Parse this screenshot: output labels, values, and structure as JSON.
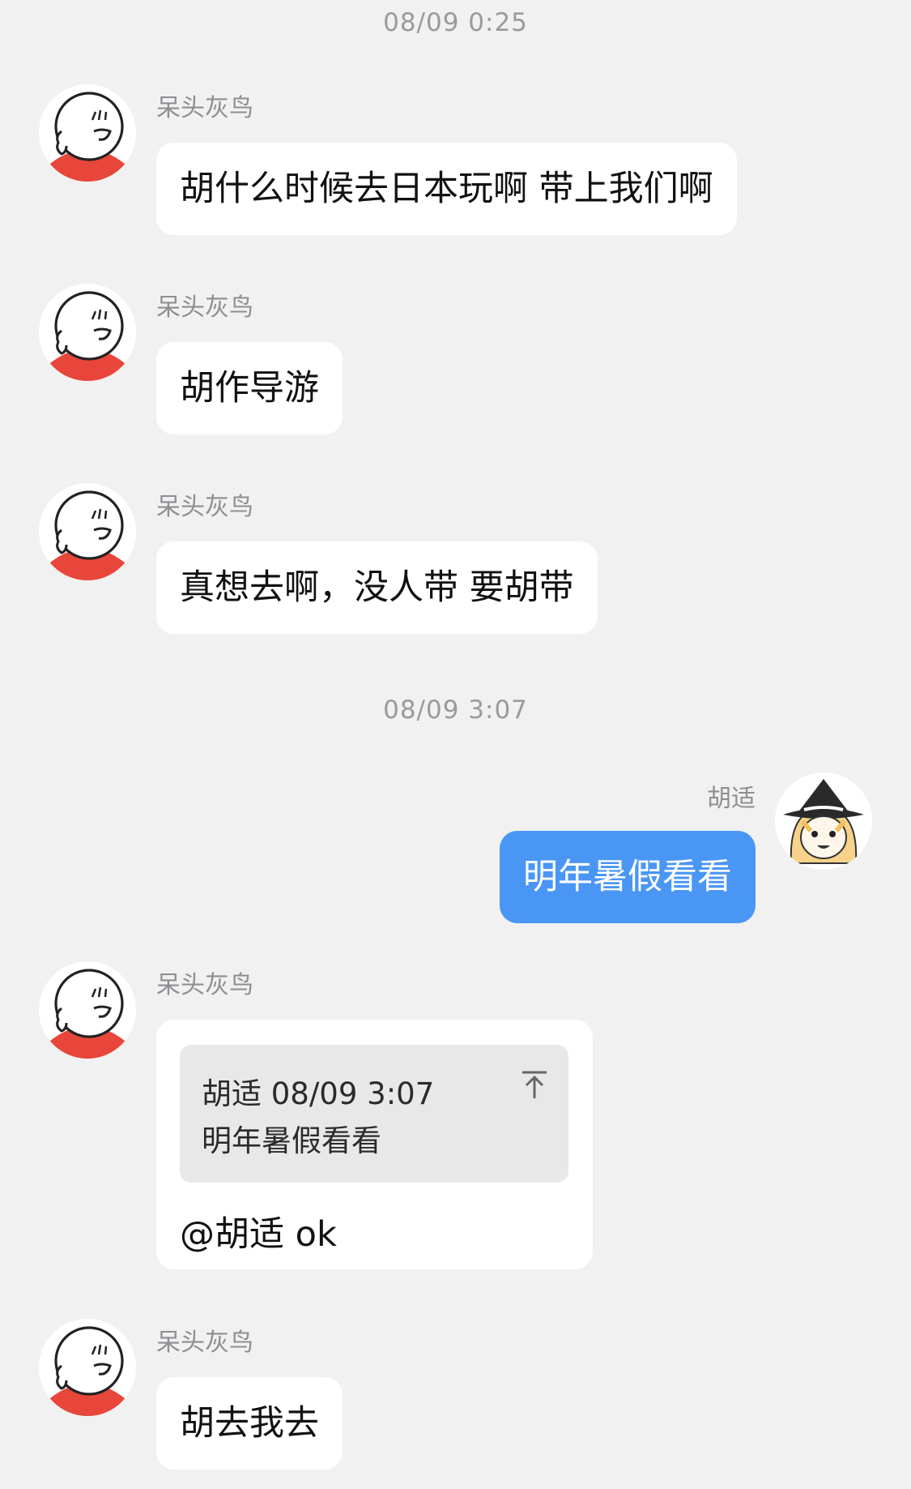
{
  "chat": {
    "timestamps": [
      "08/09 0:25",
      "08/09 3:07"
    ],
    "messages": [
      {
        "sender": "呆头灰鸟",
        "text": "胡什么时候去日本玩啊 带上我们啊",
        "side": "left"
      },
      {
        "sender": "呆头灰鸟",
        "text": "胡作导游",
        "side": "left"
      },
      {
        "sender": "呆头灰鸟",
        "text": "真想去啊，没人带 要胡带",
        "side": "left"
      },
      {
        "sender": "胡适",
        "text": "明年暑假看看",
        "side": "right"
      },
      {
        "sender": "呆头灰鸟",
        "side": "left",
        "quote": {
          "header": "胡适 08/09 3:07",
          "text": "明年暑假看看",
          "icon": "scroll-to-top-icon"
        },
        "text": "@胡适 ok"
      },
      {
        "sender": "呆头灰鸟",
        "text": "胡去我去",
        "side": "left"
      }
    ]
  },
  "colors": {
    "background": "#f1f1f1",
    "bubble_other": "#ffffff",
    "bubble_mine": "#4a96f5",
    "timestamp_text": "#9a9a9f",
    "quote_background": "#e8e8e8",
    "avatar_accent": "#e8463a"
  },
  "icons": {
    "other_avatar": "cartoon-face-avatar-icon",
    "my_avatar": "anime-witch-avatar-icon"
  }
}
